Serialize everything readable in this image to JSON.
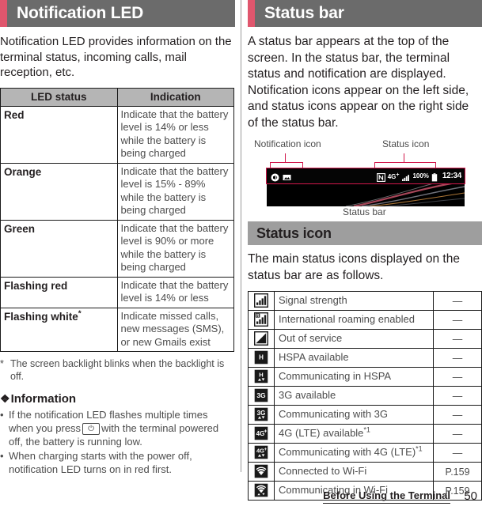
{
  "left": {
    "section_title": "Notification LED",
    "intro": "Notification LED provides information on the terminal status, incoming calls, mail reception, etc.",
    "table": {
      "headers": [
        "LED status",
        "Indication"
      ],
      "rows": [
        {
          "status": "Red",
          "indication": "Indicate that the battery level is 14% or less while the battery is being charged"
        },
        {
          "status": "Orange",
          "indication": "Indicate that the battery level is 15% - 89% while the battery is being charged"
        },
        {
          "status": "Green",
          "indication": "Indicate that the battery level is 90% or more while the battery is being charged"
        },
        {
          "status": "Flashing red",
          "indication": "Indicate that the battery level is 14% or less"
        },
        {
          "status": "Flashing white",
          "status_sup": "*",
          "indication": "Indicate missed calls, new messages (SMS), or new Gmails exist"
        }
      ]
    },
    "footnote_mark": "*",
    "footnote": "The screen backlight blinks when the backlight is off.",
    "info_heading": "Information",
    "info_diamond": "❖",
    "info_items": [
      {
        "pre": "If the notification LED flashes multiple times when you press",
        "keycap": "⏻",
        "post": "with the terminal powered off, the battery is running low."
      },
      {
        "pre": "When charging starts with the power off, notification LED turns on in red first.",
        "keycap": "",
        "post": ""
      }
    ]
  },
  "right": {
    "section_title": "Status bar",
    "intro": "A status bar appears at the top of the screen. In the status bar, the terminal status and notification are displayed. Notification icons appear on the left side, and status icons appear on the right side of the status bar.",
    "figure": {
      "label_notification": "Notification icon",
      "label_status": "Status icon",
      "label_statusbar": "Status bar",
      "statusbar": {
        "network_label": "4G",
        "network_sup": "+",
        "battery_percent": "100%",
        "time": "12:34",
        "nfc_icon": "nfc-icon",
        "notification_icons": [
          "volume-icon",
          "image-icon"
        ]
      }
    },
    "subsection_title": "Status icon",
    "subsection_intro": "The main status icons displayed on the status bar are as follows.",
    "table": {
      "rows": [
        {
          "icon": "signal-strength-icon",
          "desc": "Signal strength",
          "sup": "",
          "ref": "—"
        },
        {
          "icon": "roaming-signal-icon",
          "desc": "International roaming enabled",
          "sup": "",
          "ref": "—"
        },
        {
          "icon": "out-of-service-icon",
          "desc": "Out of service",
          "sup": "",
          "ref": "—"
        },
        {
          "icon": "hspa-available-icon",
          "desc": "HSPA available",
          "sup": "",
          "ref": "—"
        },
        {
          "icon": "hspa-communicating-icon",
          "desc": "Communicating in HSPA",
          "sup": "",
          "ref": "—"
        },
        {
          "icon": "3g-available-icon",
          "desc": "3G available",
          "sup": "",
          "ref": "—"
        },
        {
          "icon": "3g-communicating-icon",
          "desc": "Communicating with 3G",
          "sup": "",
          "ref": "—"
        },
        {
          "icon": "4g-available-icon",
          "desc": "4G (LTE) available",
          "sup": "*1",
          "ref": "—"
        },
        {
          "icon": "4g-communicating-icon",
          "desc": "Communicating with 4G (LTE)",
          "sup": "*1",
          "ref": "—"
        },
        {
          "icon": "wifi-connected-icon",
          "desc": "Connected to Wi-Fi",
          "sup": "",
          "ref": "P.159"
        },
        {
          "icon": "wifi-communicating-icon",
          "desc": "Communicating in Wi-Fi",
          "sup": "",
          "ref": "P.159"
        }
      ]
    }
  },
  "footer": {
    "chapter": "Before Using the Terminal",
    "page": "50"
  },
  "colors": {
    "accent_red": "#e0566d",
    "header_gray": "#6b6b6b",
    "subheader_gray": "#9e9e9e",
    "table_header_gray": "#b5b5b5",
    "callout_red": "#d1174b"
  }
}
